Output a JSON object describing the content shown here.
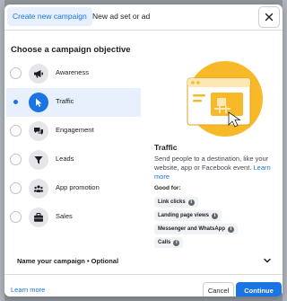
{
  "colors": {
    "accent": "#1b74e4",
    "selected_bg": "#e7f0fc",
    "illustration_yellow": "#f7b928"
  },
  "tabs": [
    {
      "label": "Create new campaign",
      "active": true
    },
    {
      "label": "New ad set or ad",
      "active": false
    }
  ],
  "section_title": "Choose a campaign objective",
  "objectives": [
    {
      "label": "Awareness",
      "icon": "megaphone-icon",
      "selected": false
    },
    {
      "label": "Traffic",
      "icon": "cursor-icon",
      "selected": true
    },
    {
      "label": "Engagement",
      "icon": "chat-bubbles-icon",
      "selected": false
    },
    {
      "label": "Leads",
      "icon": "filter-icon",
      "selected": false
    },
    {
      "label": "App promotion",
      "icon": "people-icon",
      "selected": false
    },
    {
      "label": "Sales",
      "icon": "briefcase-icon",
      "selected": false
    }
  ],
  "detail": {
    "title": "Traffic",
    "description": "Send people to a destination, like your website, app or Facebook event.",
    "learn_more": "Learn more",
    "good_for_label": "Good for:",
    "chips": [
      "Link clicks",
      "Landing page views",
      "Messenger and WhatsApp",
      "Calls"
    ]
  },
  "name_section": {
    "label": "Name your campaign • Optional"
  },
  "footer": {
    "learn_more": "Learn more",
    "cancel": "Cancel",
    "continue": "Continue"
  }
}
